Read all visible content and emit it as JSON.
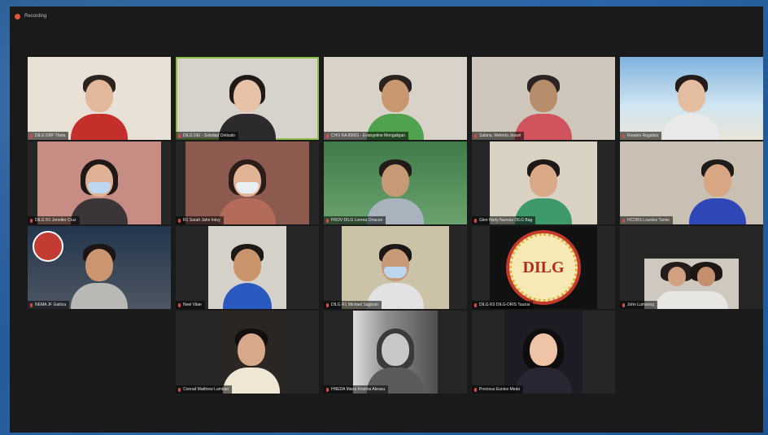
{
  "meeting": {
    "recording_label": "Recording",
    "status_color": "#e0563a"
  },
  "participants": [
    {
      "name": "DILG DRF Theta",
      "active": false,
      "mic": "muted"
    },
    {
      "name": "DILG DEI - Soledad Ontisalo",
      "active": true,
      "mic": "muted"
    },
    {
      "name": "CHO RA 89001 - Evangeline Mongaligan",
      "active": false,
      "mic": "muted"
    },
    {
      "name": "Sabina, Melinda Jessel",
      "active": false,
      "mic": "muted"
    },
    {
      "name": "Rosario Regaliza",
      "active": false,
      "mic": "muted"
    },
    {
      "name": "DILG R1 Jennifer Cruz",
      "active": false,
      "mic": "muted"
    },
    {
      "name": "R1 Sarah Jahn Intoy",
      "active": false,
      "mic": "muted"
    },
    {
      "name": "PROV DILG Lorena Ortacan",
      "active": false,
      "mic": "muted"
    },
    {
      "name": "Glen Harly Nuevas DILG Bag",
      "active": false,
      "mic": "muted"
    },
    {
      "name": "HCDRS Lourdes Tamio",
      "active": false,
      "mic": "muted"
    },
    {
      "name": "NEMA JF Gaitica",
      "active": false,
      "mic": "muted"
    },
    {
      "name": "Noel Vilan",
      "active": false,
      "mic": "muted"
    },
    {
      "name": "DILG R1 Michael Saginao",
      "active": false,
      "mic": "muted"
    },
    {
      "name": "DILG R3 DILG-DRIS Taurus",
      "active": false,
      "mic": "muted"
    },
    {
      "name": "John Lumanog",
      "active": false,
      "mic": "muted"
    },
    {
      "name": "Conrad Matthew Lumbao",
      "active": false,
      "mic": "muted"
    },
    {
      "name": "HNEDA Maria Kristina Abrasu",
      "active": false,
      "mic": "muted"
    },
    {
      "name": "Precious Eunice Meda",
      "active": false,
      "mic": "muted"
    }
  ],
  "logo": {
    "text": "DILG"
  }
}
